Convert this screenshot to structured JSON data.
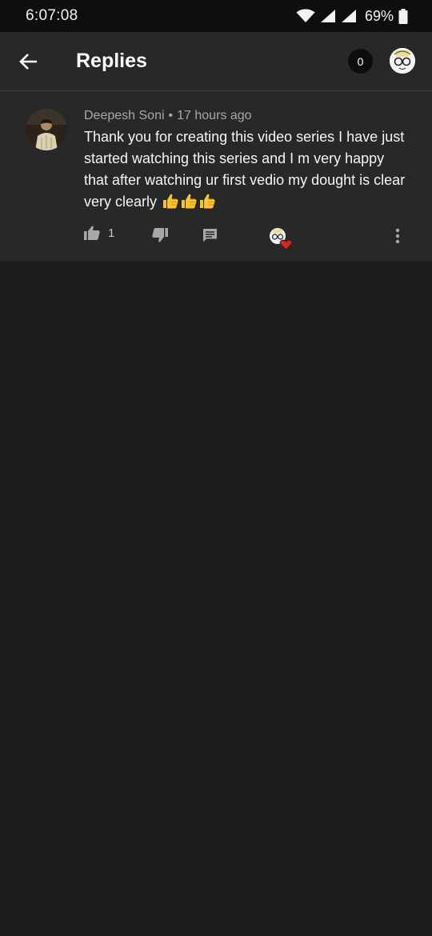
{
  "status_bar": {
    "time": "6:07:08",
    "battery": "69%"
  },
  "app_bar": {
    "title": "Replies",
    "reply_count": "0"
  },
  "comment": {
    "author": "Deepesh Soni",
    "separator": "•",
    "time_ago": "17 hours ago",
    "text": "Thank you for creating this video series I have just started watching this series and I m very happy that after watching ur first vedio my dought is clear very  clearly",
    "emojis": [
      "thumbs-up-emoji",
      "thumbs-up-emoji",
      "thumbs-up-emoji"
    ],
    "like_count": "1"
  },
  "icons": {
    "back": "arrow-left-icon",
    "like": "thumbs-up-icon",
    "dislike": "thumbs-down-icon",
    "reply": "comment-icon",
    "creator_heart": "creator-heart-icon",
    "more": "more-vert-icon"
  },
  "colors": {
    "background": "#1c1c1c",
    "surface": "#282828",
    "status_bar": "#0e0e0e",
    "heart": "#e0241b",
    "emoji": "#f7c234"
  }
}
